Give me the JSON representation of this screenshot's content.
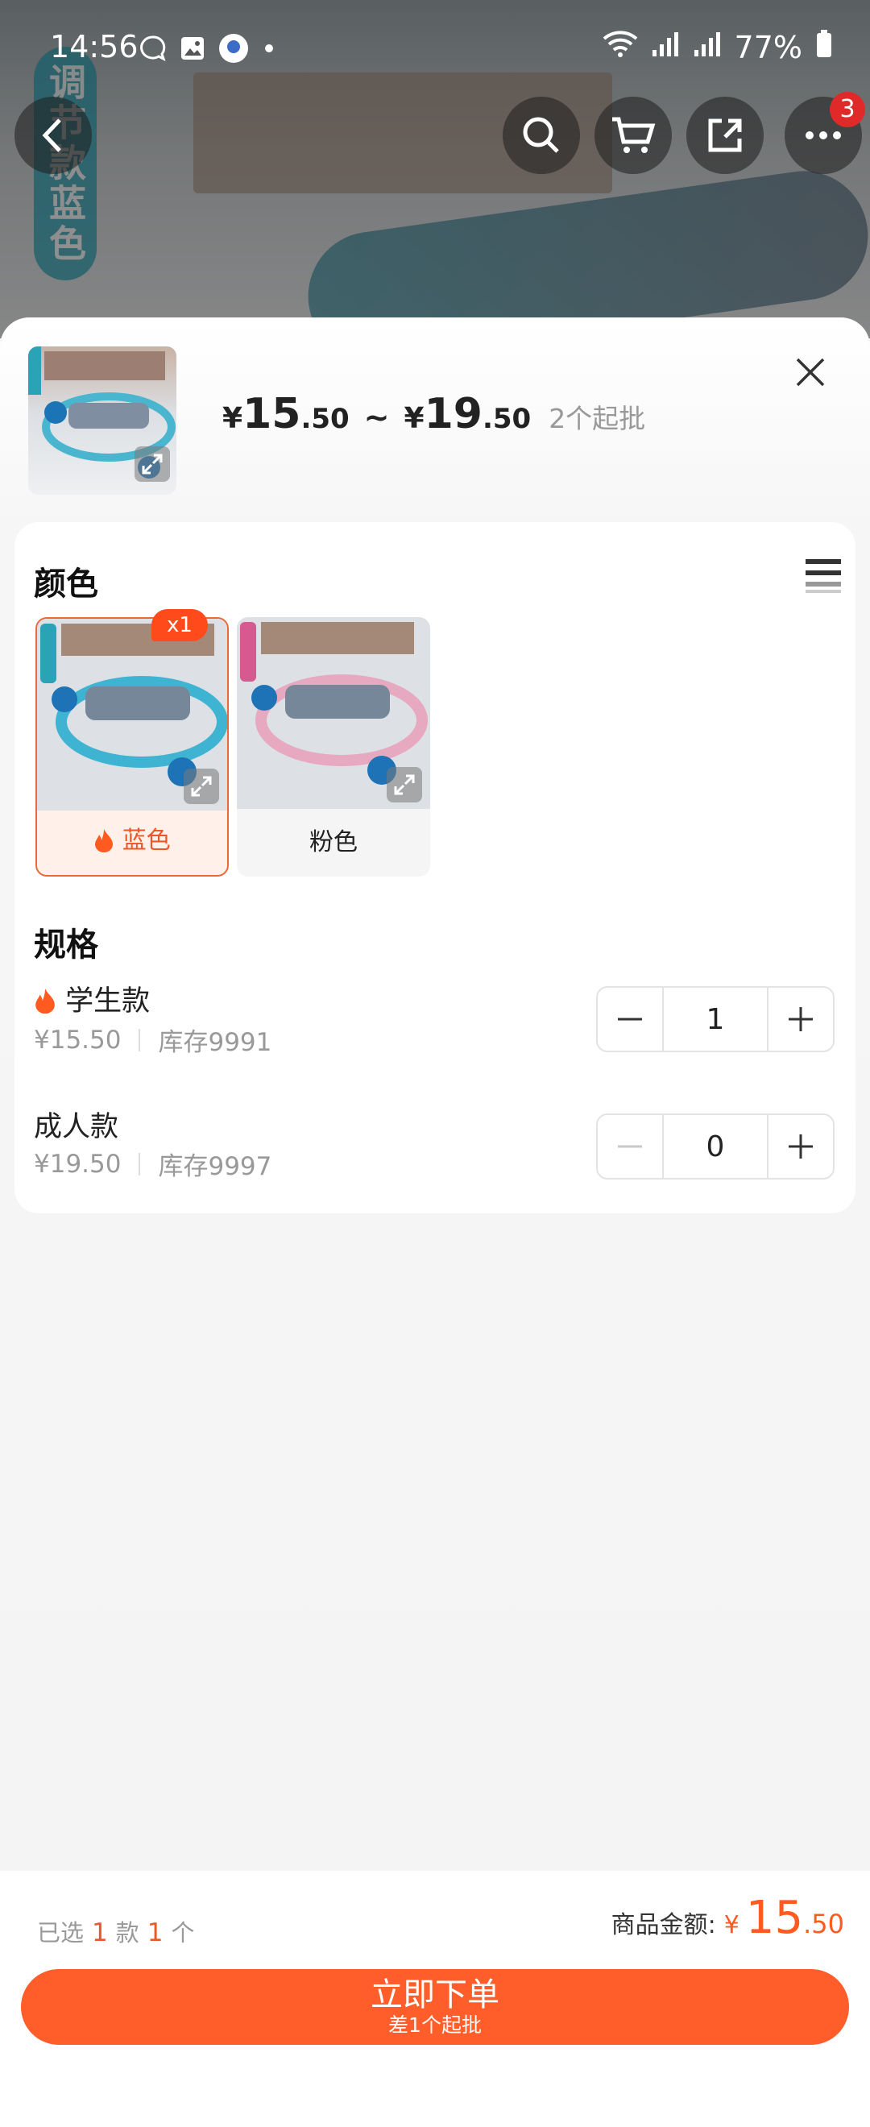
{
  "status_bar": {
    "time": "14:56",
    "battery": "77%"
  },
  "background": {
    "vertical_tag": "调节款蓝色",
    "cart_badge": "3"
  },
  "header": {
    "price_low_int": "15",
    "price_low_dec": ".50",
    "price_high_int": "19",
    "price_high_dec": ".50",
    "currency": "¥",
    "tilde": "~",
    "min_order": "2个起批"
  },
  "color_section": {
    "title": "颜色",
    "options": [
      {
        "label": "蓝色",
        "selected": true,
        "badge": "x1",
        "hot": true
      },
      {
        "label": "粉色",
        "selected": false
      }
    ]
  },
  "spec_section": {
    "title": "规格",
    "items": [
      {
        "name": "学生款",
        "hot": true,
        "price": "¥15.50",
        "stock": "库存9991",
        "qty": "1"
      },
      {
        "name": "成人款",
        "hot": false,
        "price": "¥19.50",
        "stock": "库存9997",
        "qty": "0"
      }
    ]
  },
  "bottom": {
    "selected_prefix": "已选",
    "kinds": "1",
    "kinds_unit": "款",
    "count": "1",
    "count_unit": "个",
    "total_label": "商品金额:",
    "total_currency": "¥",
    "total_int": "15",
    "total_dec": ".50",
    "order_label": "立即下单",
    "order_sub": "差1个起批"
  },
  "colors": {
    "accent": "#ff5e2a",
    "selected_border": "#e9693c"
  }
}
